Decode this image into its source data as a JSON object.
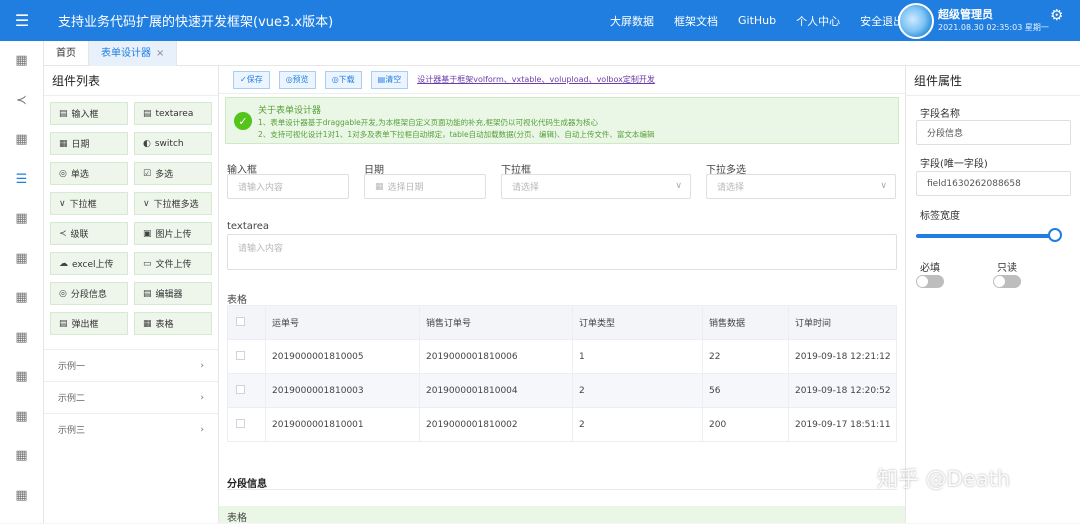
{
  "header": {
    "title": "支持业务代码扩展的快速开发框架(vue3.x版本)",
    "nav": [
      "大屏数据",
      "框架文档",
      "GitHub",
      "个人中心",
      "安全退出"
    ],
    "user_name": "超级管理员",
    "user_time": "2021.08.30 02:35:03 星期一"
  },
  "tabs": [
    {
      "label": "首页"
    },
    {
      "label": "表单设计器",
      "close": "×"
    }
  ],
  "left_panel": {
    "title": "组件列表",
    "components": [
      {
        "icon": "▤",
        "label": "输入框"
      },
      {
        "icon": "▤",
        "label": "textarea"
      },
      {
        "icon": "▦",
        "label": "日期"
      },
      {
        "icon": "◐",
        "label": "switch"
      },
      {
        "icon": "◎",
        "label": "单选"
      },
      {
        "icon": "☑",
        "label": "多选"
      },
      {
        "icon": "∨",
        "label": "下拉框"
      },
      {
        "icon": "∨",
        "label": "下拉框多选"
      },
      {
        "icon": "≺",
        "label": "级联"
      },
      {
        "icon": "▣",
        "label": "图片上传"
      },
      {
        "icon": "☁",
        "label": "excel上传"
      },
      {
        "icon": "▭",
        "label": "文件上传"
      },
      {
        "icon": "◎",
        "label": "分段信息"
      },
      {
        "icon": "▤",
        "label": "编辑器"
      },
      {
        "icon": "▤",
        "label": "弹出框"
      },
      {
        "icon": "▦",
        "label": "表格"
      }
    ],
    "examples": [
      {
        "label": "示例一",
        "arrow": "›"
      },
      {
        "label": "示例二",
        "arrow": "›"
      },
      {
        "label": "示例三",
        "arrow": "›"
      }
    ]
  },
  "toolbar": {
    "buttons": [
      "✓保存",
      "◎预览",
      "◎下载",
      "▤清空"
    ],
    "link": "设计器基于框架volform、vxtable、volupload、volbox定制开发"
  },
  "alert": {
    "title": "关于表单设计器",
    "line1": "1、表单设计器基于draggable开发,为本框架自定义页面功能的补充,框架仍以可视化代码生成器为核心",
    "line2": "2、支持可视化设计1对1、1对多及表单下拉框自动绑定，table自动加载数据(分页、编辑)、自动上传文件、富文本编辑"
  },
  "form": {
    "input_label": "输入框",
    "input_placeholder": "请输入内容",
    "date_label": "日期",
    "date_placeholder": "选择日期",
    "select_label": "下拉框",
    "select_placeholder": "请选择",
    "multiselect_label": "下拉多选",
    "multiselect_placeholder": "请选择",
    "textarea_label": "textarea",
    "textarea_placeholder": "请输入内容",
    "table_label": "表格",
    "section_title": "分段信息",
    "bottom_label": "表格"
  },
  "table": {
    "columns": [
      "运单号",
      "销售订单号",
      "订单类型",
      "销售数据",
      "订单时间"
    ],
    "rows": [
      [
        "2019000001810005",
        "2019000001810006",
        "1",
        "22",
        "2019-09-18 12:21:12"
      ],
      [
        "2019000001810003",
        "2019000001810004",
        "2",
        "56",
        "2019-09-18 12:20:52"
      ],
      [
        "2019000001810001",
        "2019000001810002",
        "2",
        "200",
        "2019-09-17 18:51:11"
      ]
    ]
  },
  "right_panel": {
    "title": "组件属性",
    "field_name_label": "字段名称",
    "field_name_value": "分段信息",
    "field_key_label": "字段(唯一字段)",
    "field_key_value": "field1630262088658",
    "label_width_label": "标签宽度",
    "label_width_value": 1.0,
    "required_label": "必填",
    "readonly_label": "只读"
  },
  "watermark": "知乎 @Death",
  "colors": {
    "primary": "#1f7ee0",
    "success": "#52c41a",
    "success_bg": "#eaf7e6"
  }
}
